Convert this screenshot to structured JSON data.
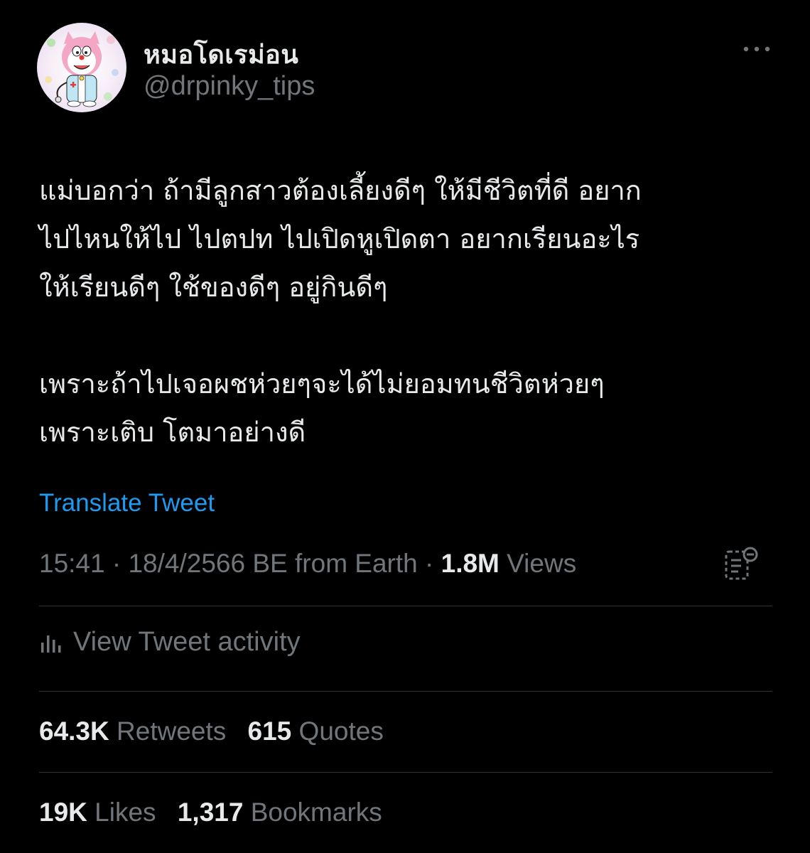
{
  "header": {
    "display_name": "หมอโดเรม่อน",
    "handle": "@drpinky_tips",
    "more_icon": "more-horizontal-icon"
  },
  "tweet": {
    "lines": [
      "แม่บอกว่า ถ้ามีลูกสาวต้องเลี้ยงดีๆ ให้มีชีวิตที่ดี อยาก",
      "ไปไหนให้ไป ไปตปท ไปเปิดหูเปิดตา อยากเรียนอะไร",
      "ให้เรียนดีๆ ใช้ของดีๆ อยู่กินดีๆ",
      "",
      "เพราะถ้าไปเจอผชห่วยๆจะได้ไม่ยอมทนชีวิตห่วยๆ",
      "เพราะเติบ โตมาอย่างดี"
    ],
    "translate_label": "Translate Tweet"
  },
  "meta": {
    "time": "15:41",
    "separator": "·",
    "date": "18/4/2566 BE",
    "source": "from Earth",
    "views_count": "1.8M",
    "views_label": "Views"
  },
  "activity": {
    "label": "View Tweet activity"
  },
  "stats": {
    "retweets_count": "64.3K",
    "retweets_label": "Retweets",
    "quotes_count": "615",
    "quotes_label": "Quotes",
    "likes_count": "19K",
    "likes_label": "Likes",
    "bookmarks_count": "1,317",
    "bookmarks_label": "Bookmarks"
  },
  "colors": {
    "background": "#000000",
    "text": "#e7e9ea",
    "secondary": "#71767b",
    "link": "#1d9bf0",
    "divider": "#2f3336"
  }
}
